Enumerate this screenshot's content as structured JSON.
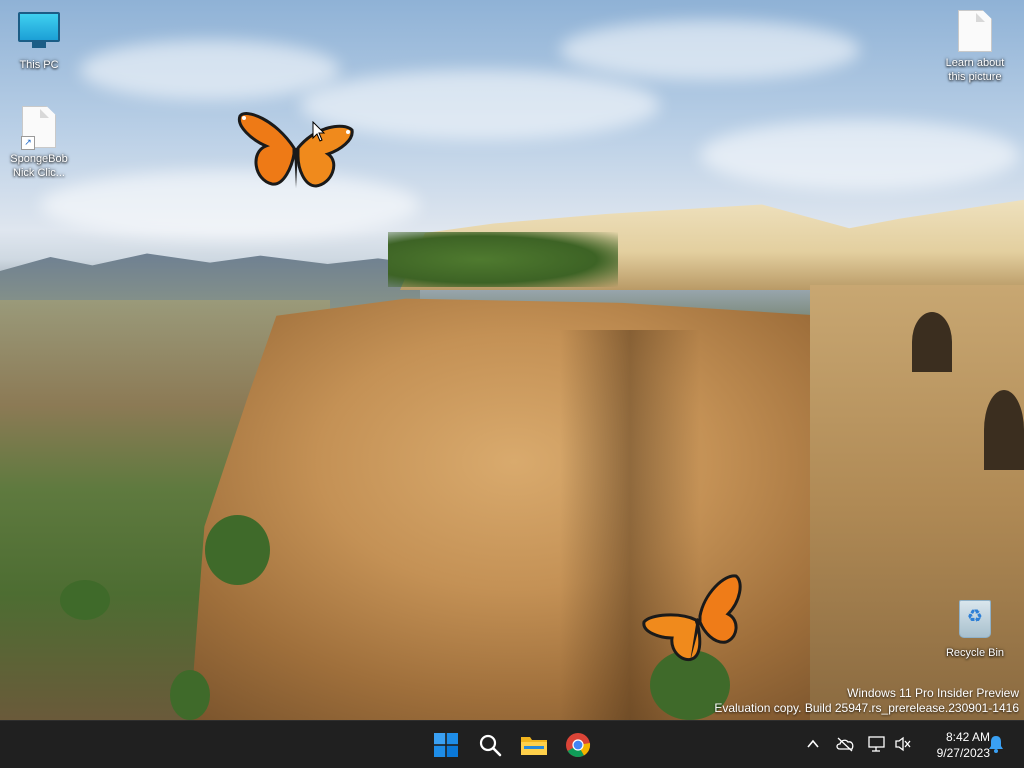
{
  "desktop": {
    "icons": [
      {
        "label": "This PC"
      },
      {
        "label": "SpongeBob Nick Clic..."
      },
      {
        "label": "Learn about this picture"
      },
      {
        "label": "Recycle Bin"
      }
    ],
    "watermark": {
      "line1": "Windows 11 Pro Insider Preview",
      "line2": "Evaluation copy. Build 25947.rs_prerelease.230901-1416"
    }
  },
  "taskbar": {
    "apps": [
      {
        "name": "start-icon"
      },
      {
        "name": "search-icon"
      },
      {
        "name": "file-explorer-icon"
      },
      {
        "name": "chrome-icon"
      }
    ],
    "tray": {
      "icons": [
        "chevron-up-icon",
        "onedrive-icon",
        "network-icon",
        "volume-muted-icon",
        "notification-bell-icon"
      ],
      "time": "8:42 AM",
      "date": "9/27/2023"
    }
  },
  "colors": {
    "taskbar_bg": "#202020",
    "accent": "#0078d4"
  }
}
